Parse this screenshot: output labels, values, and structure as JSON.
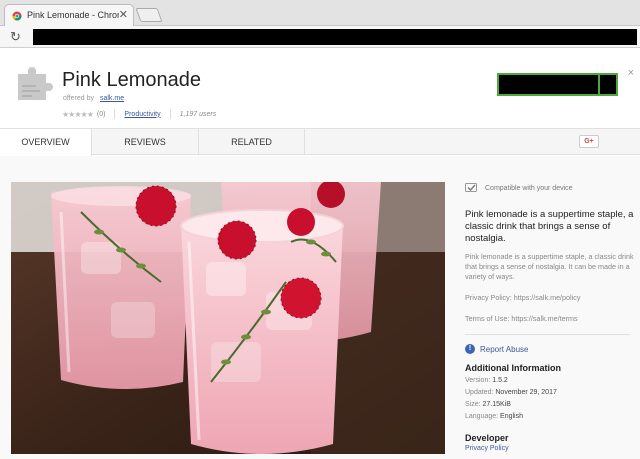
{
  "browser": {
    "tab_title": "Pink Lemonade - Chrome",
    "tab_close": "✕",
    "reload": "↻"
  },
  "header": {
    "title": "Pink Lemonade",
    "offered_by_prefix": "offered by",
    "offered_by_link": "salk.me",
    "rating_count": "(0)",
    "category": "Productivity",
    "users": "1,197 users",
    "close": "×"
  },
  "nav": {
    "tabs": [
      {
        "label": "OVERVIEW"
      },
      {
        "label": "REVIEWS"
      },
      {
        "label": "RELATED"
      }
    ],
    "gplus": "G+"
  },
  "sidebar": {
    "compatible": "Compatible with your device",
    "summary": "Pink lemonade is a suppertime staple, a classic drink that brings a sense of nostalgia.",
    "description": "Pink lemonade is a suppertime staple, a classic drink that brings a sense of nostalgia. It can be made in a variety of ways.",
    "privacy": "Privacy Policy: https://salk.me/policy",
    "terms": "Terms of Use: https://salk.me/terms",
    "report_abuse": "Report Abuse",
    "additional_title": "Additional Information",
    "version_label": "Version:",
    "version": "1.5.2",
    "updated_label": "Updated:",
    "updated": "November 29, 2017",
    "size_label": "Size:",
    "size": "27.15KiB",
    "language_label": "Language:",
    "language": "English",
    "developer_title": "Developer",
    "developer_link": "Privacy Policy"
  },
  "colors": {
    "accent_green": "#4ca93a",
    "link_blue": "#3b5998"
  }
}
